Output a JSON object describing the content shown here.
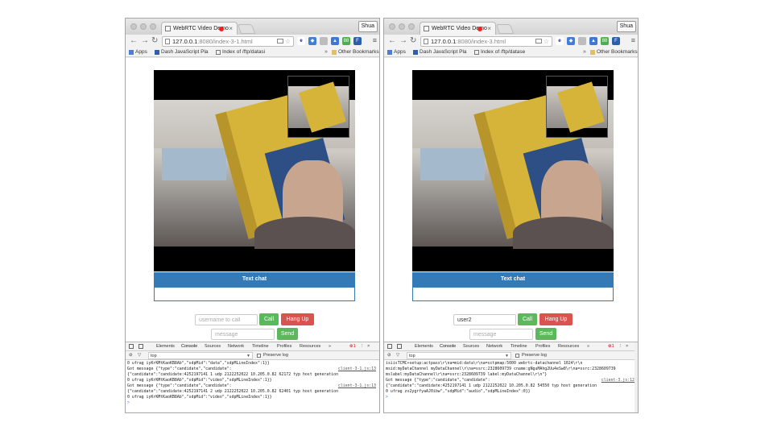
{
  "colors": {
    "panel_blue": "#337ab7",
    "btn_green": "#5cb85c",
    "btn_red": "#d9534f",
    "link_blue": "#3b7ddd"
  },
  "left": {
    "tab_title": "WebRTC Video Demo",
    "profile": "Shua",
    "url_host": "127.0.0.1",
    "url_rest": ":8080/index-3-1.html",
    "bookmarks": {
      "apps": "Apps",
      "dash": "Dash JavaScript Pla",
      "index": "Index of /ftp/datasi",
      "more": "»",
      "other": "Other Bookmarks"
    },
    "chat_header": "Text chat",
    "username_placeholder": "username to call",
    "username_value": "",
    "call_label": "Call",
    "hangup_label": "Hang Up",
    "message_placeholder": "message",
    "send_label": "Send",
    "devtools": {
      "tabs": [
        "Elements",
        "Console",
        "Sources",
        "Network",
        "Timeline",
        "Profiles",
        "Resources",
        "»"
      ],
      "error_count": "1",
      "filter": "top",
      "preserve_log": "Preserve log",
      "console_lines": [
        {
          "text": "0 ufrag iyKrKMtKaoKB8Ab\",\"sdpMid\":\"data\",\"sdpMLineIndex\":1}}",
          "src": ""
        },
        {
          "text": "Got message {\"type\":\"candidate\",\"candidate\":",
          "src": "client-3-1.js:13"
        },
        {
          "text": "{\"candidate\":\"candidate:4252197141 1 udp 2122252022 10.205.0.82 62172 typ host generation",
          "src": ""
        },
        {
          "text": "0 ufrag iyKrKMtKaoKB8Ab\",\"sdpMid\":\"video\",\"sdpMLineIndex\":1}}",
          "src": ""
        },
        {
          "text": "Got message {\"type\":\"candidate\",\"candidate\":",
          "src": "client-3-1.js:13"
        },
        {
          "text": "{\"candidate\":\"candidate:4252197141 2 udp 2122252022 10.205.0.82 62401 typ host generation",
          "src": ""
        },
        {
          "text": "0 ufrag iyKrKMtKaoKB8Ab\",\"sdpMid\":\"video\",\"sdpMLineIndex\":1}}",
          "src": ""
        },
        {
          "text": ">",
          "src": ""
        }
      ]
    }
  },
  "right": {
    "tab_title": "WebRTC Video Demo",
    "profile": "Shua",
    "url_host": "127.0.0.1",
    "url_rest": ":8080/index-3.html",
    "bookmarks": {
      "apps": "Apps",
      "dash": "Dash JavaScript Pla",
      "index": "Index of /ftp/datase",
      "more": "»",
      "other": "Other Bookmarks"
    },
    "chat_header": "Text chat",
    "username_placeholder": "",
    "username_value": "user2",
    "call_label": "Call",
    "hangup_label": "Hang Up",
    "message_placeholder": "message",
    "send_label": "Send",
    "devtools": {
      "tabs": [
        "Elements",
        "Console",
        "Sources",
        "Network",
        "Timeline",
        "Profiles",
        "Resources",
        "»"
      ],
      "error_count": "1",
      "filter": "top",
      "preserve_log": "Preserve log",
      "console_lines": [
        {
          "text": "isiisTCMC+setup:actpass\\r\\na=mid:data\\r\\na=sctpmap:5000 webrtc-datachannel 1024\\r\\n",
          "src": ""
        },
        {
          "text": "msid:myDataChannel myDataChannel\\r\\na=ssrc:2328609739 cname:gNguMAhg2Uu4eSw8\\r\\na=ssrc:2328609739",
          "src": ""
        },
        {
          "text": "mslabel:myDataChannel\\r\\na=ssrc:2328609739 label:myDataChannel\\r\\n\"}",
          "src": ""
        },
        {
          "text": "Got message {\"type\":\"candidate\",\"candidate\":",
          "src": "client-3.js:12"
        },
        {
          "text": "{\"candidate\":\"candidate:4252197141 1 udp 2122252022 10.205.0.82 54550 typ host generation",
          "src": ""
        },
        {
          "text": "0 ufrag zv2ygrfyaAJ0ibw\",\"sdpMid\":\"audio\",\"sdpMLineIndex\":0}}",
          "src": ""
        },
        {
          "text": ">",
          "src": ""
        }
      ]
    }
  }
}
